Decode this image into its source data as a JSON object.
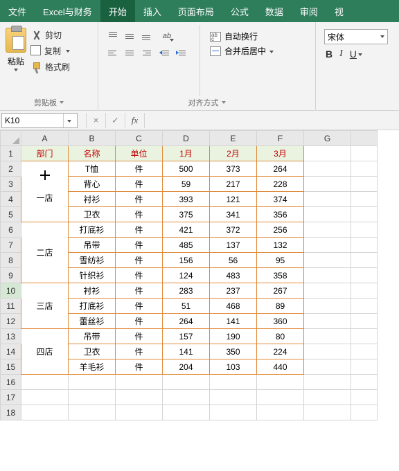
{
  "tabs": {
    "file": "文件",
    "custom": "Excel与财务",
    "home": "开始",
    "insert": "插入",
    "layout": "页面布局",
    "formula": "公式",
    "data": "数据",
    "review": "审阅",
    "view_partial": "视"
  },
  "ribbon": {
    "clipboard": {
      "paste": "粘贴",
      "cut": "剪切",
      "copy": "复制",
      "brush": "格式刷",
      "label": "剪贴板"
    },
    "alignment": {
      "wrap": "自动换行",
      "merge": "合并后居中",
      "label": "对齐方式",
      "orient_glyph": "ab",
      "wrap_glyph": "ab\nc"
    },
    "font": {
      "name": "宋体",
      "bold": "B",
      "italic": "I",
      "underline": "U"
    }
  },
  "namebox": {
    "ref": "K10",
    "cancel": "×",
    "enter": "✓",
    "fx": "fx"
  },
  "columns": [
    "A",
    "B",
    "C",
    "D",
    "E",
    "F",
    "G"
  ],
  "row_numbers": [
    1,
    2,
    3,
    4,
    5,
    6,
    7,
    8,
    9,
    10,
    11,
    12,
    13,
    14,
    15,
    16,
    17,
    18
  ],
  "headers": [
    "部门",
    "名称",
    "单位",
    "1月",
    "2月",
    "3月"
  ],
  "groups": [
    {
      "dept": "一店",
      "span": 4,
      "rows": [
        {
          "name": "T恤",
          "unit": "件",
          "m1": 500,
          "m2": 373,
          "m3": 264
        },
        {
          "name": "背心",
          "unit": "件",
          "m1": 59,
          "m2": 217,
          "m3": 228
        },
        {
          "name": "衬衫",
          "unit": "件",
          "m1": 393,
          "m2": 121,
          "m3": 374
        },
        {
          "name": "卫衣",
          "unit": "件",
          "m1": 375,
          "m2": 341,
          "m3": 356
        }
      ]
    },
    {
      "dept": "二店",
      "span": 4,
      "rows": [
        {
          "name": "打底衫",
          "unit": "件",
          "m1": 421,
          "m2": 372,
          "m3": 256
        },
        {
          "name": "吊带",
          "unit": "件",
          "m1": 485,
          "m2": 137,
          "m3": 132
        },
        {
          "name": "雪纺衫",
          "unit": "件",
          "m1": 156,
          "m2": 56,
          "m3": 95
        },
        {
          "name": "针织衫",
          "unit": "件",
          "m1": 124,
          "m2": 483,
          "m3": 358
        }
      ]
    },
    {
      "dept": "三店",
      "span": 3,
      "rows": [
        {
          "name": "衬衫",
          "unit": "件",
          "m1": 283,
          "m2": 237,
          "m3": 267
        },
        {
          "name": "打底衫",
          "unit": "件",
          "m1": 51,
          "m2": 468,
          "m3": 89
        },
        {
          "name": "蕾丝衫",
          "unit": "件",
          "m1": 264,
          "m2": 141,
          "m3": 360
        }
      ]
    },
    {
      "dept": "四店",
      "span": 3,
      "rows": [
        {
          "name": "吊带",
          "unit": "件",
          "m1": 157,
          "m2": 190,
          "m3": 80
        },
        {
          "name": "卫衣",
          "unit": "件",
          "m1": 141,
          "m2": 350,
          "m3": 224
        },
        {
          "name": "羊毛衫",
          "unit": "件",
          "m1": 204,
          "m2": 103,
          "m3": 440
        }
      ]
    }
  ],
  "chart_data": {
    "type": "table",
    "title": "",
    "columns": [
      "部门",
      "名称",
      "单位",
      "1月",
      "2月",
      "3月"
    ],
    "rows": [
      [
        "一店",
        "T恤",
        "件",
        500,
        373,
        264
      ],
      [
        "一店",
        "背心",
        "件",
        59,
        217,
        228
      ],
      [
        "一店",
        "衬衫",
        "件",
        393,
        121,
        374
      ],
      [
        "一店",
        "卫衣",
        "件",
        375,
        341,
        356
      ],
      [
        "二店",
        "打底衫",
        "件",
        421,
        372,
        256
      ],
      [
        "二店",
        "吊带",
        "件",
        485,
        137,
        132
      ],
      [
        "二店",
        "雪纺衫",
        "件",
        156,
        56,
        95
      ],
      [
        "二店",
        "针织衫",
        "件",
        124,
        483,
        358
      ],
      [
        "三店",
        "衬衫",
        "件",
        283,
        237,
        267
      ],
      [
        "三店",
        "打底衫",
        "件",
        51,
        468,
        89
      ],
      [
        "三店",
        "蕾丝衫",
        "件",
        264,
        141,
        360
      ],
      [
        "四店",
        "吊带",
        "件",
        157,
        190,
        80
      ],
      [
        "四店",
        "卫衣",
        "件",
        141,
        350,
        224
      ],
      [
        "四店",
        "羊毛衫",
        "件",
        204,
        103,
        440
      ]
    ]
  }
}
